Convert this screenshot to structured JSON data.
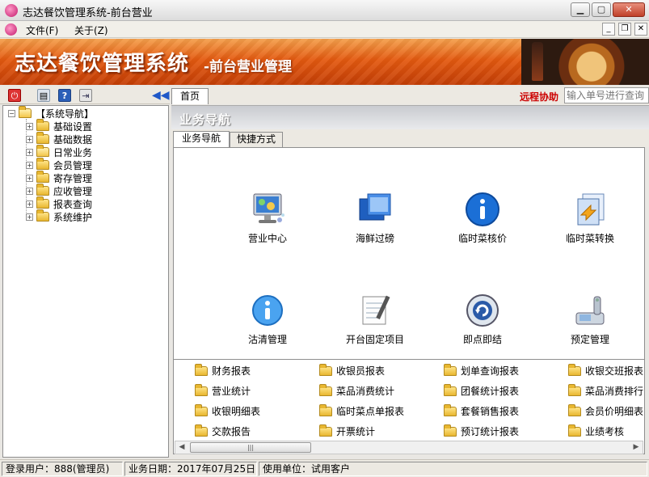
{
  "window": {
    "title": "志达餐饮管理系统-前台营业"
  },
  "menu": {
    "items": [
      "文件(F)",
      "关于(Z)"
    ]
  },
  "banner": {
    "title": "志达餐饮管理系统",
    "subtitle": "-前台营业管理"
  },
  "tree": {
    "root": "【系统导航】",
    "items": [
      "基础设置",
      "基础数据",
      "日常业务",
      "会员管理",
      "寄存管理",
      "应收管理",
      "报表查询",
      "系统维护"
    ]
  },
  "tabs": {
    "home": "首页",
    "remote": "远程协助",
    "search_placeholder": "输入单号进行查询"
  },
  "nav": {
    "title": "业务导航",
    "subtabs": [
      "业务导航",
      "快捷方式"
    ]
  },
  "features": [
    {
      "label": "营业中心",
      "icon": "monitor-icon"
    },
    {
      "label": "海鲜过磅",
      "icon": "windows-icon"
    },
    {
      "label": "临时菜核价",
      "icon": "info-icon"
    },
    {
      "label": "临时菜转换",
      "icon": "document-convert-icon"
    },
    {
      "label": "沽清管理",
      "icon": "info-icon"
    },
    {
      "label": "开台固定项目",
      "icon": "notepad-icon"
    },
    {
      "label": "即点即结",
      "icon": "refresh-icon"
    },
    {
      "label": "预定管理",
      "icon": "phone-icon"
    }
  ],
  "reports": [
    "财务报表",
    "收银员报表",
    "划单查询报表",
    "收银交班报表",
    "营业统计",
    "菜品消费统计",
    "团餐统计报表",
    "菜品消费排行",
    "收银明细表",
    "临时菜点单报表",
    "套餐销售报表",
    "会员价明细表",
    "交款报告",
    "开票统计",
    "预订统计报表",
    "业绩考核"
  ],
  "status": {
    "user": "登录用户：888(管理员)",
    "date": "业务日期：2017年07月25日",
    "unit": "使用单位：试用客户"
  },
  "colors": {
    "banner": "#e45a10",
    "remote": "#cc0000"
  }
}
